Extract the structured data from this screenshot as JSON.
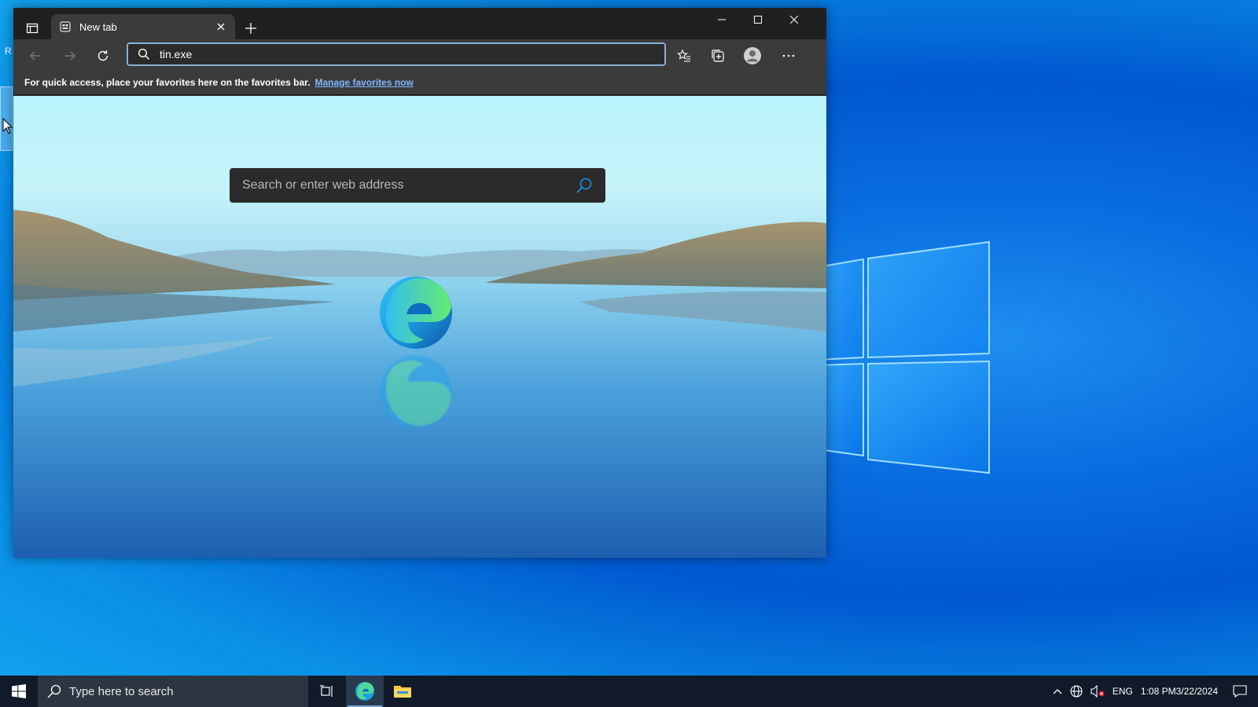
{
  "desktop": {
    "icon_label_fragment": "R"
  },
  "browser": {
    "tab": {
      "title": "New tab"
    },
    "address_bar": {
      "value": "tin.exe"
    },
    "favorites_bar": {
      "message": "For quick access, place your favorites here on the favorites bar.",
      "link_label": "Manage favorites now"
    },
    "new_tab_page": {
      "search_placeholder": "Search or enter web address"
    }
  },
  "taskbar": {
    "search_placeholder": "Type here to search",
    "language": "ENG",
    "time": "1:08 PM",
    "date": "3/22/2024"
  },
  "icons": [
    "tab-actions-icon",
    "new-tab-page-icon",
    "close-icon",
    "plus-icon",
    "minimize-icon",
    "maximize-icon",
    "back-icon",
    "forward-icon",
    "refresh-icon",
    "search-icon",
    "favorites-icon",
    "collections-icon",
    "profile-icon",
    "more-icon",
    "edge-logo-icon",
    "windows-start-icon",
    "task-view-icon",
    "edge-icon",
    "file-explorer-icon",
    "chevron-up-icon",
    "network-icon",
    "volume-muted-icon",
    "notifications-icon"
  ],
  "colors": {
    "accent": "#0078d4",
    "link": "#7fb8ff",
    "taskbar": "#101a28",
    "browser_frame": "#202020"
  }
}
